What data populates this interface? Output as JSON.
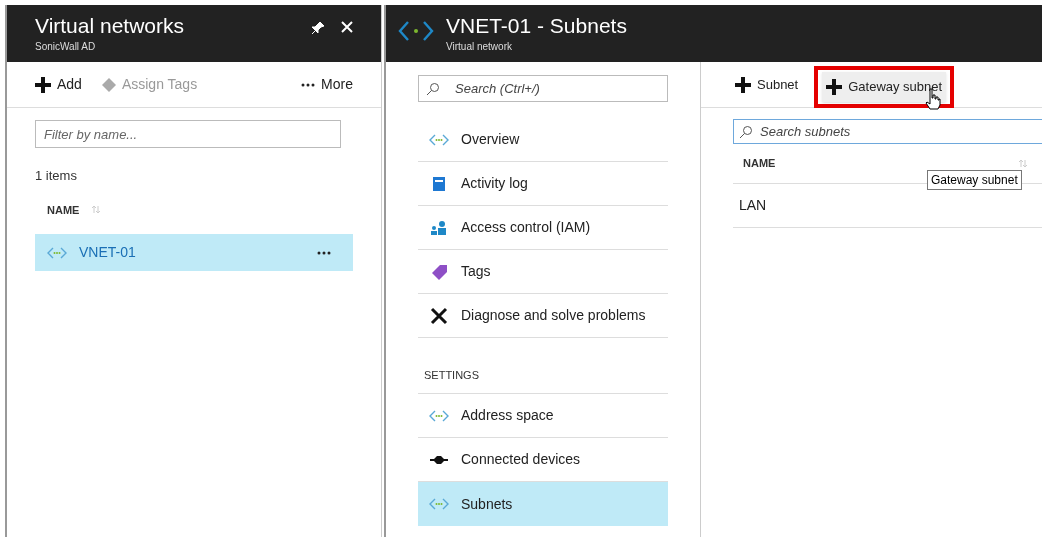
{
  "left_blade": {
    "title": "Virtual networks",
    "subtitle": "SonicWall AD",
    "toolbar": [
      {
        "kind": "add",
        "label": "Add",
        "disabled": false
      },
      {
        "kind": "tag",
        "label": "Assign Tags",
        "disabled": true
      },
      {
        "kind": "more",
        "label": "More",
        "disabled": false
      }
    ],
    "filter": {
      "placeholder": "Filter by name..."
    },
    "count": "1 items",
    "column": "NAME",
    "rows": [
      {
        "name": "VNET-01",
        "selected": true
      }
    ]
  },
  "middle_blade": {
    "title": "VNET-01 - Subnets",
    "subtitle": "Virtual network",
    "search": {
      "placeholder": "Search (Ctrl+/)"
    },
    "menu": [
      {
        "kind": "network",
        "label": "Overview",
        "selected": false
      },
      {
        "kind": "log",
        "label": "Activity log",
        "selected": false
      },
      {
        "kind": "iam",
        "label": "Access control (IAM)",
        "selected": false
      },
      {
        "kind": "tag",
        "label": "Tags",
        "selected": false
      },
      {
        "kind": "tools",
        "label": "Diagnose and solve problems",
        "selected": false
      },
      {
        "kind": "section",
        "label": "SETTINGS"
      },
      {
        "kind": "network",
        "label": "Address space",
        "selected": false
      },
      {
        "kind": "devices",
        "label": "Connected devices",
        "selected": false
      },
      {
        "kind": "network",
        "label": "Subnets",
        "selected": true
      }
    ]
  },
  "right_blade": {
    "toolbar": [
      {
        "label": "Subnet",
        "highlighted": false
      },
      {
        "label": "Gateway subnet",
        "highlighted": true
      }
    ],
    "tooltip": "Gateway subnet",
    "search": {
      "placeholder": "Search subnets"
    },
    "column": "NAME",
    "rows": [
      "LAN"
    ]
  }
}
